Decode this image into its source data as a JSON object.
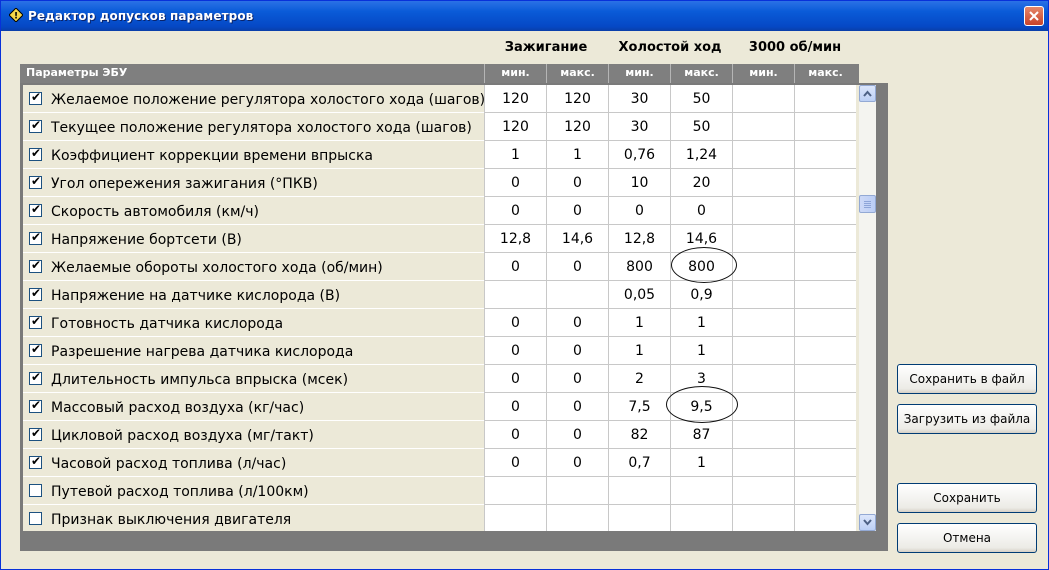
{
  "window": {
    "title": "Редактор допусков параметров",
    "close_icon": "close-icon"
  },
  "groups": [
    "Зажигание",
    "Холостой ход",
    "3000 об/мин"
  ],
  "grid": {
    "name_header": "Параметры ЭБУ",
    "sub_headers": [
      "мин.",
      "макс.",
      "мин.",
      "макс.",
      "мин.",
      "макс."
    ]
  },
  "rows": [
    {
      "checked": true,
      "label": "Желаемое положение регулятора холостого хода (шагов)",
      "values": [
        "120",
        "120",
        "30",
        "50",
        "",
        ""
      ]
    },
    {
      "checked": true,
      "label": "Текущее положение регулятора холостого хода (шагов)",
      "values": [
        "120",
        "120",
        "30",
        "50",
        "",
        ""
      ]
    },
    {
      "checked": true,
      "label": "Коэффициент коррекции времени впрыска",
      "values": [
        "1",
        "1",
        "0,76",
        "1,24",
        "",
        ""
      ]
    },
    {
      "checked": true,
      "label": "Угол опережения зажигания (°ПКВ)",
      "values": [
        "0",
        "0",
        "10",
        "20",
        "",
        ""
      ]
    },
    {
      "checked": true,
      "label": "Скорость автомобиля (км/ч)",
      "values": [
        "0",
        "0",
        "0",
        "0",
        "",
        ""
      ]
    },
    {
      "checked": true,
      "label": "Напряжение бортсети (В)",
      "values": [
        "12,8",
        "14,6",
        "12,8",
        "14,6",
        "",
        ""
      ]
    },
    {
      "checked": true,
      "label": "Желаемые обороты холостого хода (об/мин)",
      "values": [
        "0",
        "0",
        "800",
        "800",
        "",
        ""
      ]
    },
    {
      "checked": true,
      "label": "Напряжение на датчике кислорода (В)",
      "values": [
        "",
        "",
        "0,05",
        "0,9",
        "",
        ""
      ]
    },
    {
      "checked": true,
      "label": "Готовность датчика кислорода",
      "values": [
        "0",
        "0",
        "1",
        "1",
        "",
        ""
      ]
    },
    {
      "checked": true,
      "label": "Разрешение нагрева датчика кислорода",
      "values": [
        "0",
        "0",
        "1",
        "1",
        "",
        ""
      ]
    },
    {
      "checked": true,
      "label": "Длительность импульса впрыска (мсек)",
      "values": [
        "0",
        "0",
        "2",
        "3",
        "",
        ""
      ]
    },
    {
      "checked": true,
      "label": "Массовый расход воздуха (кг/час)",
      "values": [
        "0",
        "0",
        "7,5",
        "9,5",
        "",
        ""
      ]
    },
    {
      "checked": true,
      "label": "Цикловой расход воздуха (мг/такт)",
      "values": [
        "0",
        "0",
        "82",
        "87",
        "",
        ""
      ]
    },
    {
      "checked": true,
      "label": "Часовой расход топлива (л/час)",
      "values": [
        "0",
        "0",
        "0,7",
        "1",
        "",
        ""
      ]
    },
    {
      "checked": false,
      "label": "Путевой расход топлива (л/100км)",
      "values": [
        "",
        "",
        "",
        "",
        "",
        ""
      ]
    },
    {
      "checked": false,
      "label": "Признак выключения двигателя",
      "values": [
        "",
        "",
        "",
        "",
        "",
        ""
      ]
    }
  ],
  "buttons": {
    "save_to_file": "Сохранить в файл",
    "load_from_file": "Загрузить из файла",
    "save": "Сохранить",
    "cancel": "Отмена"
  },
  "check_mark": "✔"
}
